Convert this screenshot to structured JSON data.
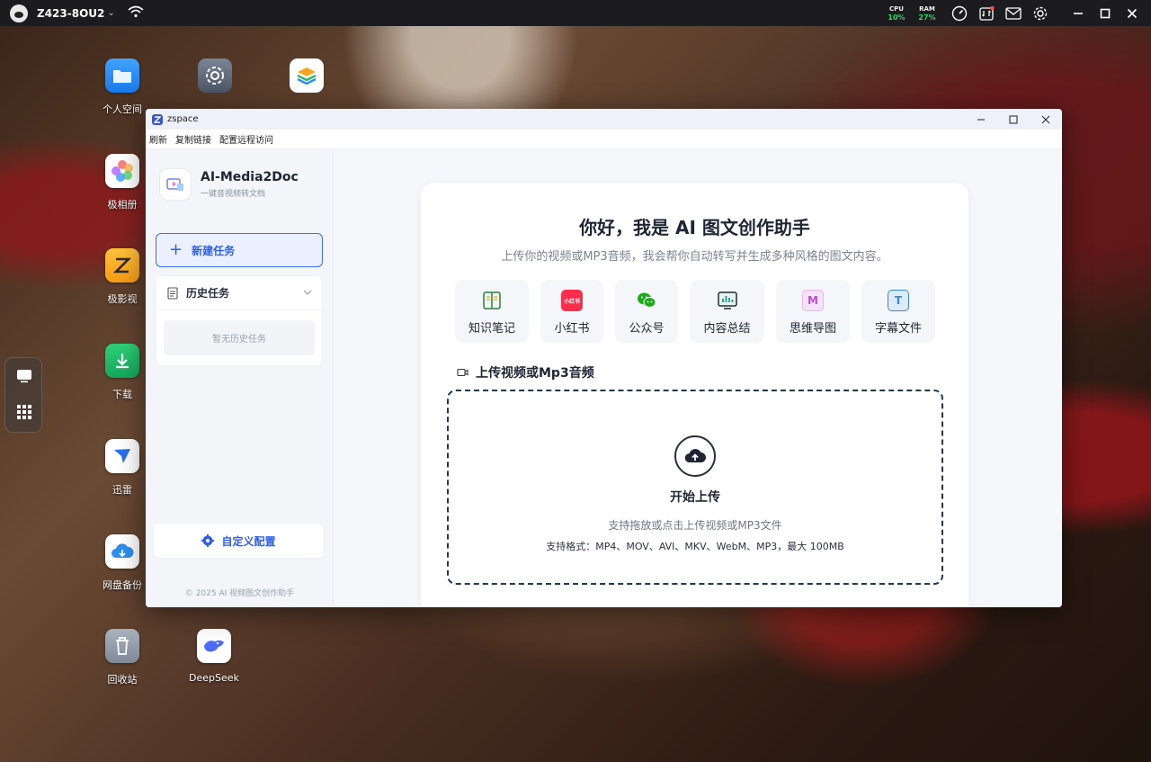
{
  "topbar": {
    "device_name": "Z423-8OU2",
    "cpu_label": "CPU",
    "cpu_value": "10%",
    "ram_label": "RAM",
    "ram_value": "27%",
    "accent_green": "#27d86a"
  },
  "desktop_icons": [
    {
      "name": "个人空间",
      "icon": "folder-icon"
    },
    {
      "name": "极相册",
      "icon": "photos-icon"
    },
    {
      "name": "极影视",
      "icon": "video-icon"
    },
    {
      "name": "下载",
      "icon": "download-icon"
    },
    {
      "name": "迅雷",
      "icon": "thunder-icon"
    },
    {
      "name": "网盘备份",
      "icon": "cloud-backup-icon"
    },
    {
      "name": "回收站",
      "icon": "trash-icon"
    },
    {
      "name": "DeepSeek",
      "icon": "deepseek-icon"
    }
  ],
  "window": {
    "title": "zspace",
    "menu": [
      "刷新",
      "复制链接",
      "配置远程访问"
    ]
  },
  "sidebar": {
    "brand_title": "AI-Media2Doc",
    "brand_subtitle": "一键音视频转文档",
    "new_task": "新建任务",
    "history_label": "历史任务",
    "history_empty": "暂无历史任务",
    "custom_config": "自定义配置",
    "footer": "© 2025 AI 视频图文创作助手"
  },
  "main": {
    "greeting": "你好，我是 AI 图文创作助手",
    "subtitle": "上传你的视频或MP3音频，我会帮你自动转写并生成多种风格的图文内容。",
    "features": [
      {
        "label": "知识笔记",
        "icon": "notebook-icon",
        "color": "#2f9a58"
      },
      {
        "label": "小红书",
        "icon": "xiaohongshu-icon",
        "color": "#ff2e4d",
        "icon_text": "小红书"
      },
      {
        "label": "公众号",
        "icon": "wechat-icon",
        "color": "#1aad19"
      },
      {
        "label": "内容总结",
        "icon": "chart-summary-icon",
        "color": "#1f9a8a"
      },
      {
        "label": "思维导图",
        "icon": "mindmap-icon",
        "color": "#c04bd8",
        "icon_text": "M"
      },
      {
        "label": "字幕文件",
        "icon": "subtitle-icon",
        "color": "#3a86d8",
        "icon_text": "T"
      }
    ],
    "upload_title": "上传视频或Mp3音频",
    "start_upload": "开始上传",
    "upload_hint": "支持拖放或点击上传视频或MP3文件",
    "formats": "支持格式：MP4、MOV、AVI、MKV、WebM、MP3，最大 100MB",
    "accent_blue": "#2f5fe8"
  }
}
